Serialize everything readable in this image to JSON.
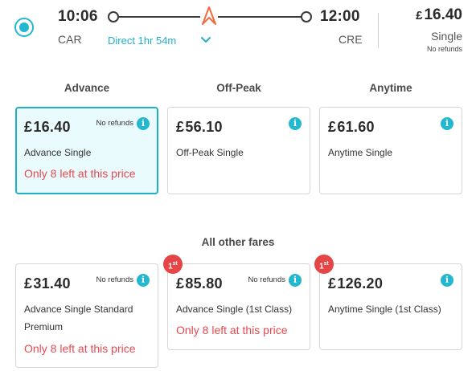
{
  "journey": {
    "departure_time": "10:06",
    "arrival_time": "12:00",
    "departure_station": "CAR",
    "arrival_station": "CRE",
    "direct_label": "Direct 1hr 54m",
    "price_currency": "£",
    "price_amount": "16.40",
    "ticket_type": "Single",
    "refund_note": "No refunds"
  },
  "columns": [
    "Advance",
    "Off-Peak",
    "Anytime"
  ],
  "other_fares_heading": "All other fares",
  "fares": [
    {
      "currency": "£",
      "amount": "16.40",
      "no_refunds": "No refunds",
      "name": "Advance Single",
      "availability": "Only 8 left at this price",
      "selected": true
    },
    {
      "currency": "£",
      "amount": "56.10",
      "no_refunds": "",
      "name": "Off-Peak Single",
      "availability": ""
    },
    {
      "currency": "£",
      "amount": "61.60",
      "no_refunds": "",
      "name": "Anytime Single",
      "availability": ""
    }
  ],
  "other_fares": [
    {
      "currency": "£",
      "amount": "31.40",
      "no_refunds": "No refunds",
      "name": "Advance Single Standard Premium",
      "availability": "Only 8 left at this price",
      "badge": ""
    },
    {
      "currency": "£",
      "amount": "85.80",
      "no_refunds": "No refunds",
      "name": "Advance Single (1st Class)",
      "availability": "Only 8 left at this price",
      "badge": "1st"
    },
    {
      "currency": "£",
      "amount": "126.20",
      "no_refunds": "",
      "name": "Anytime Single (1st Class)",
      "availability": "",
      "badge": "1st"
    }
  ],
  "icons": {
    "radio": "radio-selected-icon",
    "info": "info-icon",
    "chevron": "chevron-down-icon",
    "operator": "operator-logo-icon"
  },
  "colors": {
    "accent": "#22b8cf",
    "selected_bg": "#e9fbfd",
    "warning": "#e6484f",
    "badge": "#e64545"
  }
}
